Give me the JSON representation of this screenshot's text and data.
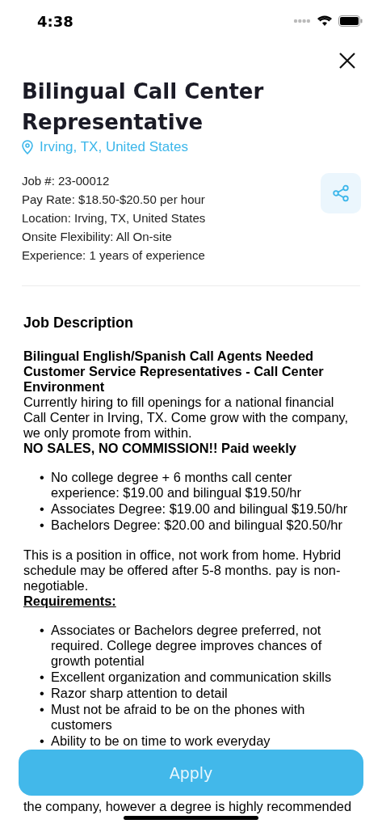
{
  "status_bar": {
    "time": "4:38"
  },
  "job": {
    "title": "Bilingual Call Center Representative",
    "location": "Irving, TX, United States",
    "details": [
      "Job #: 23-00012",
      "Pay Rate: $18.50-$20.50 per hour",
      "Location: Irving, TX, United States",
      "Onsite Flexibility: All On-site",
      "Experience: 1 years of experience"
    ]
  },
  "description": {
    "heading": "Job Description",
    "blocks": [
      {
        "kind": "bold",
        "text": "Bilingual English/Spanish Call Agents Needed Customer Service Representatives - Call Center Environment"
      },
      {
        "kind": "text",
        "text": "Currently hiring to fill openings for a national financial Call Center in Irving, TX. Come grow with the company, we only promote from within."
      },
      {
        "kind": "bold",
        "text": "NO SALES, NO COMMISSION!! Paid weekly"
      },
      {
        "kind": "list",
        "marker": "•",
        "items": [
          "No college degree + 6 months call center experience: $19.00 and bilingual $19.50/hr",
          "Associates Degree: $19.00 and bilingual $19.50/hr",
          "Bachelors Degree: $20.00 and bilingual $20.50/hr"
        ]
      },
      {
        "kind": "text",
        "text": "This is a position in office, not work from home. Hybrid schedule may be offered after 5-8 months. pay is non-negotiable."
      },
      {
        "kind": "heading",
        "text": "Requirements:"
      },
      {
        "kind": "list",
        "marker": "•",
        "items": [
          "Associates or Bachelors degree preferred, not required. College degree improves chances of growth potential",
          "Excellent organization and communication skills",
          "Razor sharp attention to detail",
          "Must not be afraid to be on the phones with customers",
          "Ability to be on time to work everyday"
        ]
      },
      {
        "kind": "hidden-text",
        "text": "the company, however a degree is highly recommended"
      }
    ]
  },
  "apply_button": {
    "label": "Apply"
  }
}
